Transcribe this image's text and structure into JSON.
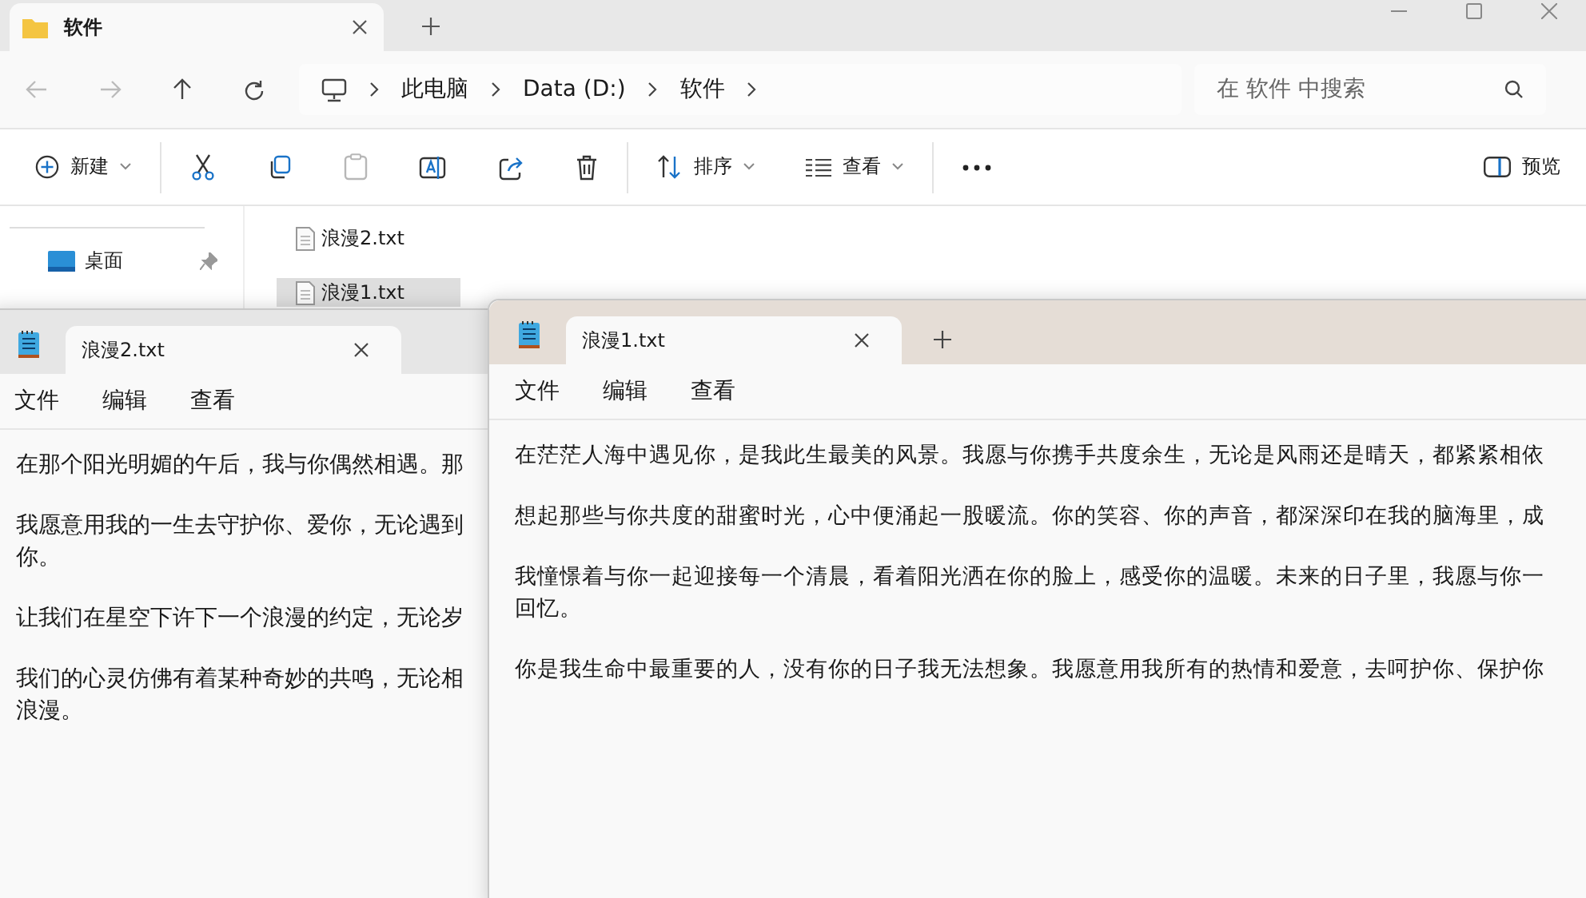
{
  "explorer": {
    "tab": {
      "title": "软件"
    },
    "breadcrumb": [
      "此电脑",
      "Data (D:)",
      "软件"
    ],
    "search": {
      "placeholder": "在 软件 中搜索"
    },
    "toolbar": [
      {
        "kind": "new",
        "label": "新建",
        "disabled": false
      },
      {
        "kind": "cut",
        "disabled": false
      },
      {
        "kind": "copy",
        "disabled": false
      },
      {
        "kind": "paste",
        "disabled": true
      },
      {
        "kind": "rename",
        "disabled": false
      },
      {
        "kind": "share",
        "disabled": false
      },
      {
        "kind": "delete",
        "disabled": false
      },
      {
        "kind": "sort",
        "label": "排序",
        "disabled": false
      },
      {
        "kind": "view",
        "label": "查看",
        "disabled": false
      },
      {
        "kind": "more",
        "disabled": false
      }
    ],
    "preview": {
      "label": "预览"
    },
    "sidebar": {
      "items": [
        {
          "label": "桌面",
          "pinned": true
        }
      ]
    },
    "files": [
      {
        "name": "浪漫2.txt",
        "selected": false
      },
      {
        "name": "浪漫1.txt",
        "selected": true
      }
    ]
  },
  "notepads": [
    {
      "active": false,
      "tab": {
        "title": "浪漫2.txt"
      },
      "menu": [
        "文件",
        "编辑",
        "查看"
      ],
      "paragraphs": [
        [
          "在那个阳光明媚的午后，我与你偶然相遇。那"
        ],
        [
          "我愿意用我的一生去守护你、爱你，无论遇到",
          "你。"
        ],
        [
          "让我们在星空下许下一个浪漫的约定，无论岁"
        ],
        [
          "我们的心灵仿佛有着某种奇妙的共鸣，无论相",
          "浪漫。"
        ]
      ]
    },
    {
      "active": true,
      "tab": {
        "title": "浪漫1.txt"
      },
      "menu": [
        "文件",
        "编辑",
        "查看"
      ],
      "paragraphs": [
        [
          "在茫茫人海中遇见你，是我此生最美的风景。我愿与你携手共度余生，无论是风雨还是晴天，都紧紧相依"
        ],
        [
          "想起那些与你共度的甜蜜时光，心中便涌起一股暖流。你的笑容、你的声音，都深深印在我的脑海里，成"
        ],
        [
          "我憧憬着与你一起迎接每一个清晨，看着阳光洒在你的脸上，感受你的温暖。未来的日子里，我愿与你一",
          "回忆。"
        ],
        [
          "你是我生命中最重要的人，没有你的日子我无法想象。我愿意用我所有的热情和爱意，去呵护你、保护你"
        ]
      ]
    }
  ]
}
